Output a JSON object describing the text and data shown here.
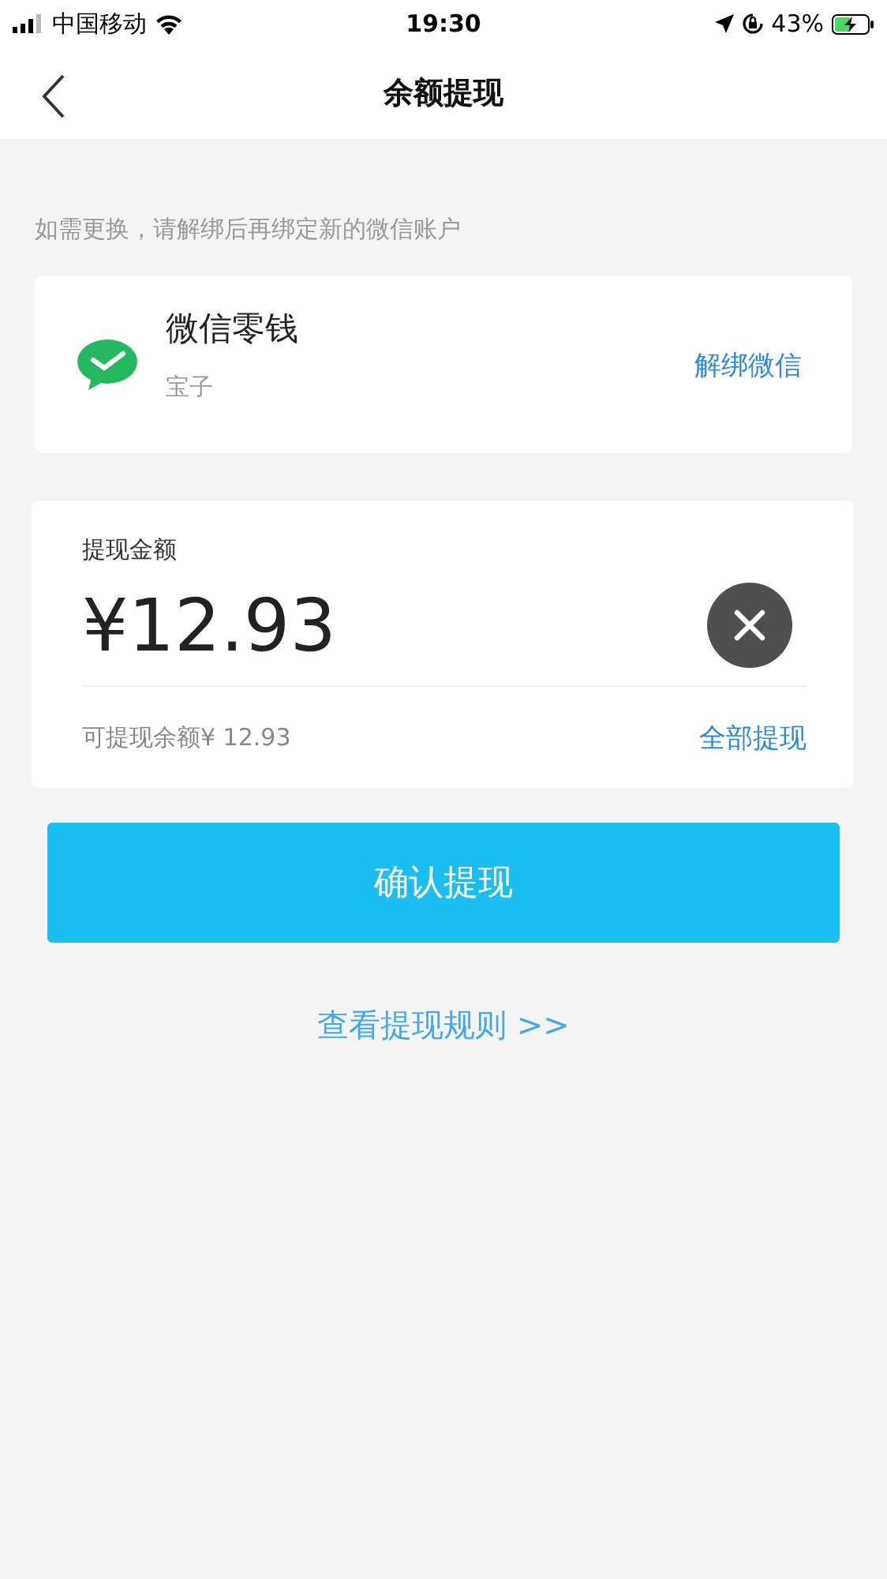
{
  "status_bar": {
    "carrier": "中国移动",
    "time": "19:30",
    "battery": "43%"
  },
  "nav": {
    "title": "余额提现"
  },
  "hint": "如需更换，请解绑后再绑定新的微信账户",
  "account": {
    "name": "微信零钱",
    "nickname": "宝子",
    "action": "解绑微信"
  },
  "amount": {
    "label": "提现金额",
    "value": "¥12.93",
    "available": "可提现余额¥ 12.93",
    "action": "全部提现"
  },
  "confirm": "确认提现",
  "rules_link": "查看提现规则 >>"
}
